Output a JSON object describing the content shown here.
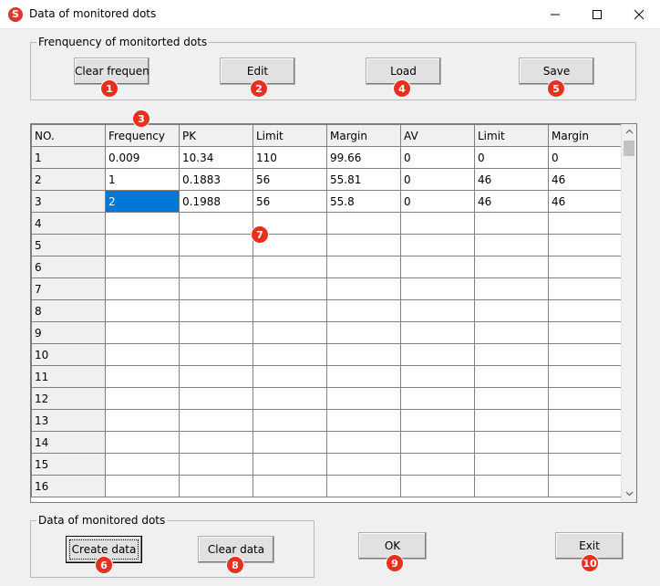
{
  "window": {
    "title": "Data of monitored dots",
    "icon_letter": "S"
  },
  "top_group": {
    "legend": "Frenquency of monitorted dots",
    "buttons": [
      {
        "label": "Clear frequency",
        "badge": "1"
      },
      {
        "label": "Edit",
        "badge": "2"
      },
      {
        "label": "Load",
        "badge": "4"
      },
      {
        "label": "Save",
        "badge": "5"
      }
    ]
  },
  "grid": {
    "header_badge": "3",
    "body_badge": "7",
    "columns": [
      "NO.",
      "Frequency",
      "PK",
      "Limit",
      "Margin",
      "AV",
      "Limit",
      "Margin"
    ],
    "rows": [
      [
        "1",
        "0.009",
        "10.34",
        "110",
        "99.66",
        "0",
        "0",
        "0"
      ],
      [
        "2",
        "1",
        "0.1883",
        "56",
        "55.81",
        "0",
        "46",
        "46"
      ],
      [
        "3",
        "2",
        "0.1988",
        "56",
        "55.8",
        "0",
        "46",
        "46"
      ],
      [
        "4",
        "",
        "",
        "",
        "",
        "",
        "",
        ""
      ],
      [
        "5",
        "",
        "",
        "",
        "",
        "",
        "",
        ""
      ],
      [
        "6",
        "",
        "",
        "",
        "",
        "",
        "",
        ""
      ],
      [
        "7",
        "",
        "",
        "",
        "",
        "",
        "",
        ""
      ],
      [
        "8",
        "",
        "",
        "",
        "",
        "",
        "",
        ""
      ],
      [
        "9",
        "",
        "",
        "",
        "",
        "",
        "",
        ""
      ],
      [
        "10",
        "",
        "",
        "",
        "",
        "",
        "",
        ""
      ],
      [
        "11",
        "",
        "",
        "",
        "",
        "",
        "",
        ""
      ],
      [
        "12",
        "",
        "",
        "",
        "",
        "",
        "",
        ""
      ],
      [
        "13",
        "",
        "",
        "",
        "",
        "",
        "",
        ""
      ],
      [
        "14",
        "",
        "",
        "",
        "",
        "",
        "",
        ""
      ],
      [
        "15",
        "",
        "",
        "",
        "",
        "",
        "",
        ""
      ],
      [
        "16",
        "",
        "",
        "",
        "",
        "",
        "",
        ""
      ]
    ],
    "selected_cell": {
      "row": 2,
      "col": 1
    },
    "selection_color": "#0078d7"
  },
  "bottom_group": {
    "legend": "Data of monitored dots",
    "buttons": [
      {
        "label": "Create data",
        "badge": "6"
      },
      {
        "label": "Clear data",
        "badge": "8"
      }
    ]
  },
  "dialog_buttons": {
    "ok": {
      "label": "OK",
      "badge": "9"
    },
    "exit": {
      "label": "Exit",
      "badge": "10"
    }
  },
  "colors": {
    "badge": "#e8301f",
    "window_bg": "#f0f0f0"
  },
  "icons": {
    "app": "app-logo-icon",
    "minimize": "minimize-icon",
    "maximize": "maximize-icon",
    "close": "close-icon"
  }
}
